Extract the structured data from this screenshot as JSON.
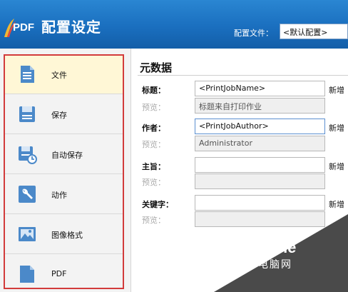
{
  "header": {
    "logo_text": "PDF",
    "title": "配置设定",
    "profile_label": "配置文件：",
    "profile_value": "<默认配置>"
  },
  "sidebar": {
    "items": [
      {
        "label": "文件",
        "icon": "document-icon"
      },
      {
        "label": "保存",
        "icon": "save-icon"
      },
      {
        "label": "自动保存",
        "icon": "autosave-icon"
      },
      {
        "label": "动作",
        "icon": "wrench-icon"
      },
      {
        "label": "图像格式",
        "icon": "image-icon"
      },
      {
        "label": "PDF",
        "icon": "pdf-file-icon"
      }
    ]
  },
  "main": {
    "section_title": "元数据",
    "rows": [
      {
        "label": "标题：",
        "value": "<PrintJobName>",
        "action": "新增",
        "preview_label": "预览：",
        "preview": "标题来自打印作业"
      },
      {
        "label": "作者：",
        "value": "<PrintJobAuthor>",
        "action": "新增",
        "preview_label": "预览：",
        "preview": "Administrator"
      },
      {
        "label": "主旨：",
        "value": "",
        "action": "新增",
        "preview_label": "预览：",
        "preview": ""
      },
      {
        "label": "关键字：",
        "value": "",
        "action": "新增",
        "preview_label": "预览：",
        "preview": ""
      }
    ]
  },
  "watermark": {
    "brand": "PConline",
    "sub": "太平洋电脑网"
  },
  "colors": {
    "header_blue": "#1a6fbf",
    "active_item_bg": "#fff7d6",
    "highlight_frame": "#d23b3b"
  }
}
